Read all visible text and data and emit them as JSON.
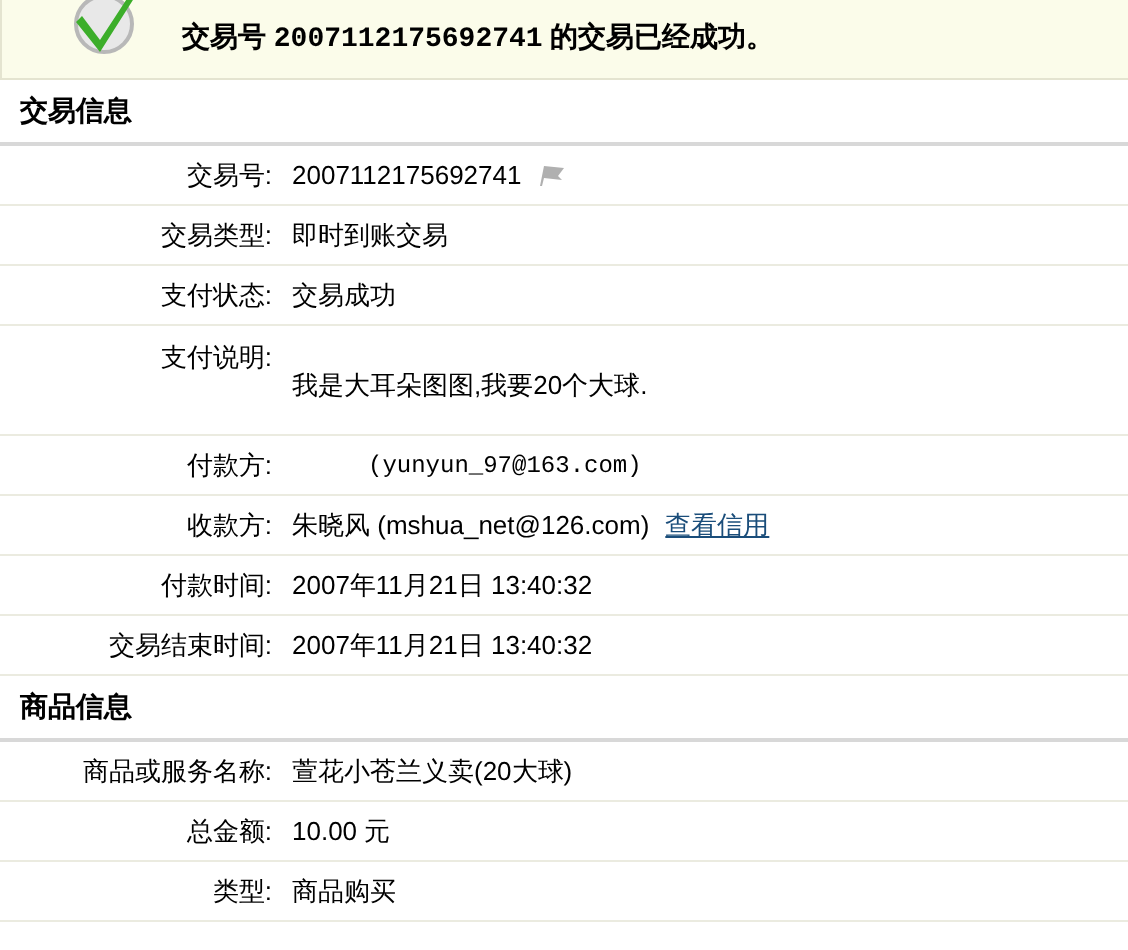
{
  "banner": {
    "prefix": "交易号",
    "trade_no": "2007112175692741",
    "suffix": "的交易已经成功。"
  },
  "sections": [
    {
      "title": "交易信息",
      "rows": [
        {
          "kind": "flag",
          "label": "交易号:",
          "value": "2007112175692741"
        },
        {
          "kind": "text",
          "label": "交易类型:",
          "value": "即时到账交易"
        },
        {
          "kind": "text",
          "label": "支付状态:",
          "value": "交易成功"
        },
        {
          "kind": "tall",
          "label": "支付说明:",
          "value": "我是大耳朵图图,我要20个大球."
        },
        {
          "kind": "indent",
          "label": "付款方:",
          "value": "(yunyun_97@163.com)"
        },
        {
          "kind": "link",
          "label": "收款方:",
          "value": "朱晓风 (mshua_net@126.com)",
          "link": "查看信用"
        },
        {
          "kind": "text",
          "label": "付款时间:",
          "value": "2007年11月21日 13:40:32"
        },
        {
          "kind": "text",
          "label": "交易结束时间:",
          "value": "2007年11月21日 13:40:32"
        }
      ]
    },
    {
      "title": "商品信息",
      "rows": [
        {
          "kind": "text",
          "label": "商品或服务名称:",
          "value": "萱花小苍兰义卖(20大球)"
        },
        {
          "kind": "text",
          "label": "总金额:",
          "value": "10.00 元"
        },
        {
          "kind": "text",
          "label": "类型:",
          "value": "商品购买"
        }
      ]
    }
  ]
}
